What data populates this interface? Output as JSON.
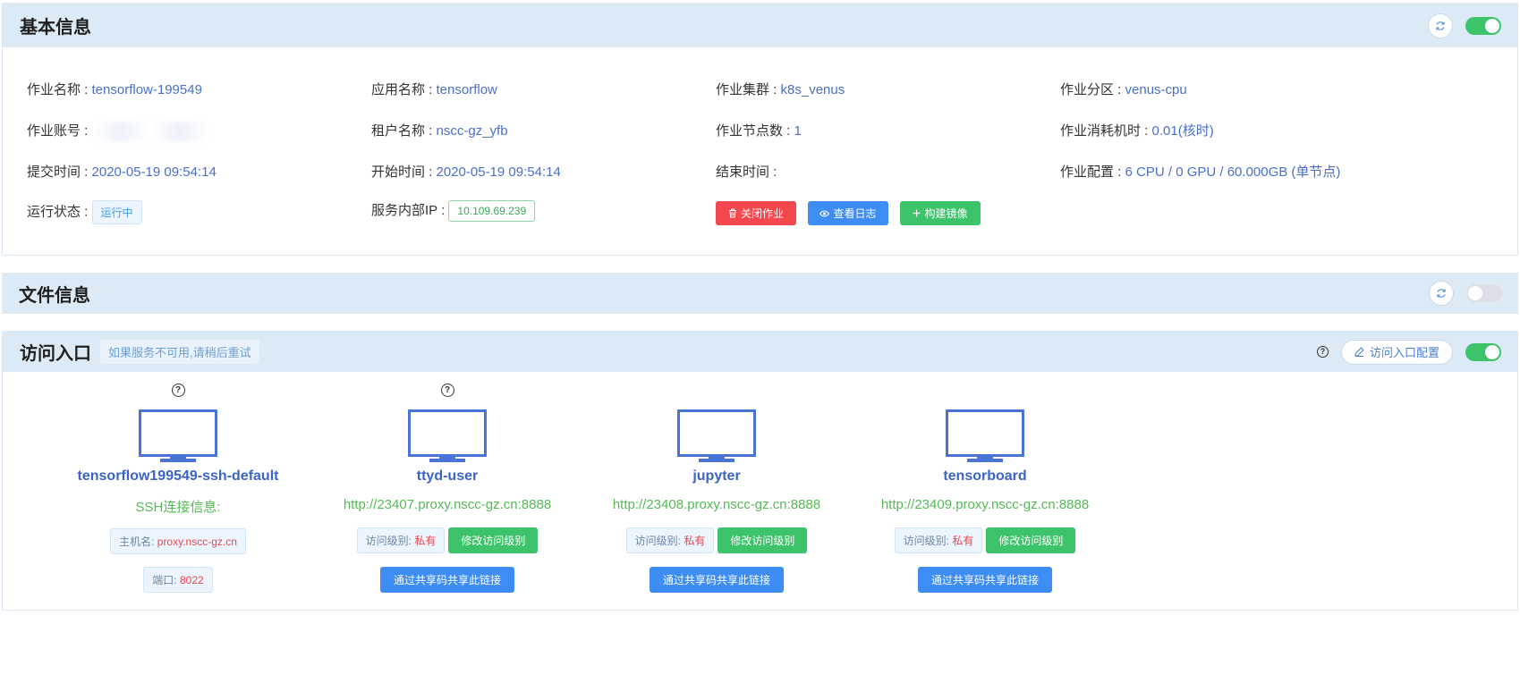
{
  "basic": {
    "title": "基本信息",
    "fields": {
      "job_name": {
        "label": "作业名称 : ",
        "value": "tensorflow-199549"
      },
      "app_name": {
        "label": "应用名称 : ",
        "value": "tensorflow"
      },
      "cluster": {
        "label": "作业集群 : ",
        "value": "k8s_venus"
      },
      "partition": {
        "label": "作业分区 : ",
        "value": "venus-cpu"
      },
      "account": {
        "label": "作业账号 : ",
        "value": ""
      },
      "tenant": {
        "label": "租户名称 : ",
        "value": "nscc-gz_yfb"
      },
      "nodes": {
        "label": "作业节点数 : ",
        "value": "1"
      },
      "core_hours": {
        "label": "作业消耗机时 : ",
        "value": "0.01(核时)"
      },
      "submit_time": {
        "label": "提交时间 : ",
        "value": "2020-05-19 09:54:14"
      },
      "start_time": {
        "label": "开始时间 : ",
        "value": "2020-05-19 09:54:14"
      },
      "end_time": {
        "label": "结束时间 : ",
        "value": ""
      },
      "config": {
        "label": "作业配置 : ",
        "value": "6 CPU / 0 GPU / 60.000GB (单节点)"
      },
      "status": {
        "label": "运行状态 : ",
        "value": "运行中"
      },
      "internal_ip": {
        "label": "服务内部IP : ",
        "value": "10.109.69.239"
      }
    },
    "buttons": {
      "close": "关闭作业",
      "log": "查看日志",
      "build": "构建镜像"
    }
  },
  "files": {
    "title": "文件信息"
  },
  "access": {
    "title": "访问入口",
    "hint": "如果服务不可用,请稍后重试",
    "config_button": "访问入口配置",
    "entries": [
      {
        "name": "tensorflow199549-ssh-default",
        "info_title": "SSH连接信息:",
        "host_label": "主机名:",
        "host": "proxy.nscc-gz.cn",
        "port_label": "端口:",
        "port": "8022"
      },
      {
        "name": "ttyd-user",
        "url": "http://23407.proxy.nscc-gz.cn:8888",
        "level_label": "访问级别:",
        "level": "私有",
        "modify": "修改访问级别",
        "share": "通过共享码共享此链接"
      },
      {
        "name": "jupyter",
        "url": "http://23408.proxy.nscc-gz.cn:8888",
        "level_label": "访问级别:",
        "level": "私有",
        "modify": "修改访问级别",
        "share": "通过共享码共享此链接"
      },
      {
        "name": "tensorboard",
        "url": "http://23409.proxy.nscc-gz.cn:8888",
        "level_label": "访问级别:",
        "level": "私有",
        "modify": "修改访问级别",
        "share": "通过共享码共享此链接"
      }
    ]
  },
  "icons": {
    "refresh": "refresh-icon",
    "monitor": "monitor-icon",
    "help": "question-circle-icon",
    "trash": "trash-icon",
    "eye": "eye-icon",
    "plus": "plus-icon",
    "edit": "edit-icon"
  },
  "colors": {
    "accent_blue": "#4a6fc8",
    "switch_on": "#3dc36a",
    "danger": "#f5484e",
    "primary": "#3d8df5",
    "url_green": "#55b955"
  }
}
